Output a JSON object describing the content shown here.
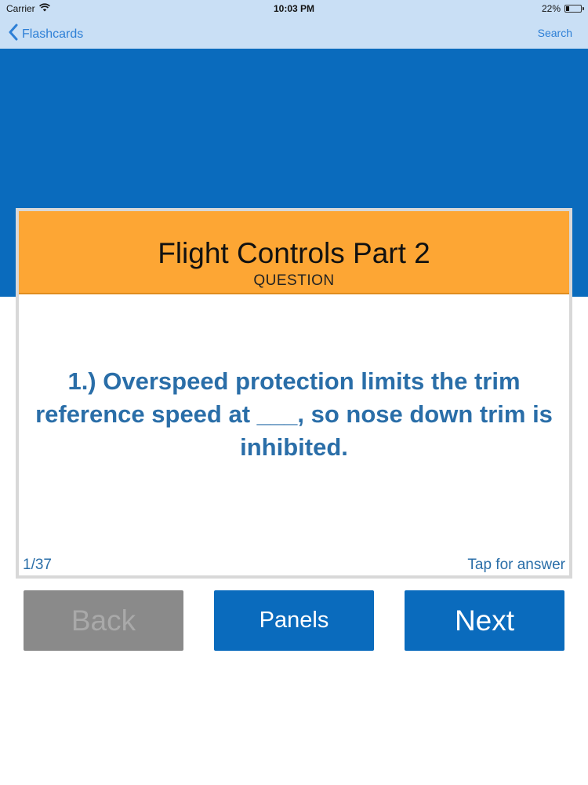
{
  "status_bar": {
    "carrier": "Carrier",
    "time": "10:03 PM",
    "battery_percent": "22%",
    "battery_level": 0.22
  },
  "nav": {
    "back_label": "Flashcards",
    "search_label": "Search"
  },
  "card": {
    "title": "Flight Controls Part 2",
    "subtitle": "QUESTION",
    "question": "1.) Overspeed protection limits the trim reference speed at ___, so nose down trim is inhibited.",
    "count": "1/37",
    "tap_hint": "Tap for answer"
  },
  "buttons": {
    "back": "Back",
    "panels": "Panels",
    "next": "Next"
  },
  "colors": {
    "nav_background": "#c9dff5",
    "brand_blue": "#0a6bbd",
    "header_orange": "#fda634",
    "question_text": "#2a6ea8",
    "disabled_gray": "#8a8a8a"
  },
  "icons": {
    "wifi": "wifi-icon",
    "battery": "battery-icon",
    "back_chevron": "chevron-left-icon"
  }
}
